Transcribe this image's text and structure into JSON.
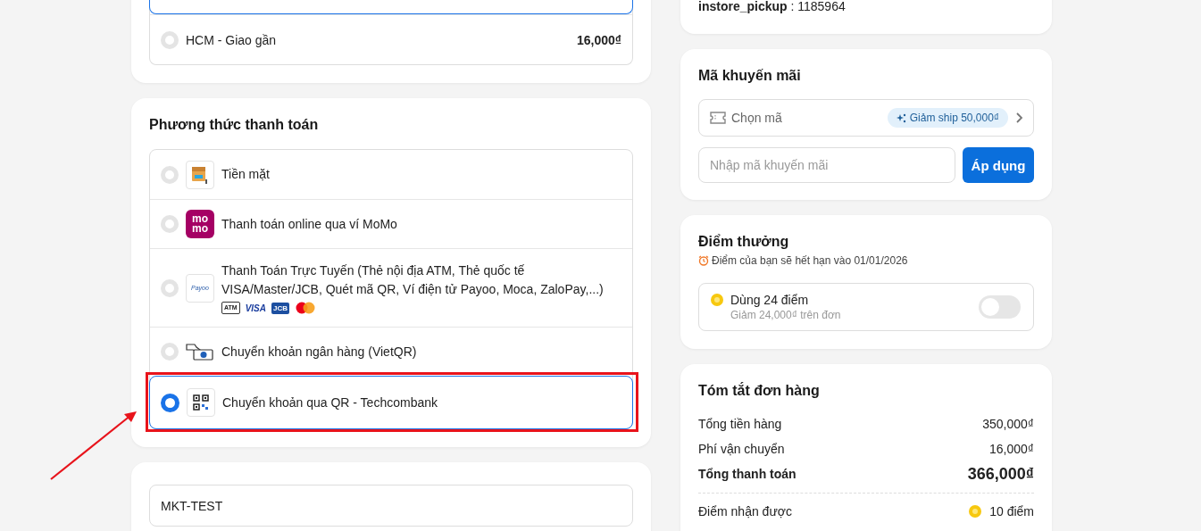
{
  "shipping": {
    "options": [
      {
        "selected": true
      },
      {
        "label": "HCM - Giao gần",
        "price": "16,000₫",
        "selected": false
      }
    ]
  },
  "payment": {
    "title": "Phương thức thanh toán",
    "methods": [
      {
        "kind": "cash",
        "label": "Tiền mặt",
        "selected": false
      },
      {
        "kind": "momo",
        "label": "Thanh toán online qua ví MoMo",
        "logo_lines": [
          "mo",
          "mo"
        ],
        "selected": false
      },
      {
        "kind": "payoo",
        "label": "Thanh Toán Trực Tuyến (Thẻ nội địa ATM, Thẻ quốc tế VISA/Master/JCB, Quét mã QR, Ví điện tử Payoo, Moca, ZaloPay,...)",
        "logo_text": "Payoo",
        "card_logos": [
          {
            "kind": "atm",
            "text": "ATM"
          },
          {
            "kind": "visa",
            "text": "VISA"
          },
          {
            "kind": "jcb",
            "text": "JCB"
          },
          {
            "kind": "mastercard"
          }
        ],
        "selected": false
      },
      {
        "kind": "bank",
        "label": "Chuyển khoản ngân hàng (VietQR)",
        "selected": false
      },
      {
        "kind": "qr",
        "label": "Chuyển khoản qua QR - Techcombank",
        "selected": true
      }
    ]
  },
  "note": {
    "value": "MKT-TEST"
  },
  "pickup": {
    "text": "**instore_pickup** : 1185964"
  },
  "promo": {
    "title": "Mã khuyến mãi",
    "picker_label": "Chọn mã",
    "badge": "Giảm ship 50,000₫",
    "input_placeholder": "Nhập mã khuyến mãi",
    "apply_button": "Áp dụng"
  },
  "points": {
    "title": "Điểm thưởng",
    "expiry": "Điểm của bạn sẽ hết hạn vào 01/01/2026",
    "use_label": "Dùng 24 điểm",
    "use_note": "Giảm 24,000₫ trên đơn",
    "on": false
  },
  "summary": {
    "title": "Tóm tắt đơn hàng",
    "rows": [
      {
        "kind": "line",
        "label": "Tổng tiền hàng",
        "value": "350,000₫"
      },
      {
        "kind": "line",
        "label": "Phí vận chuyển",
        "value": "16,000₫"
      },
      {
        "kind": "total",
        "label": "Tổng thanh toán",
        "value": "366,000₫"
      },
      {
        "kind": "points",
        "label": "Điểm nhận được",
        "value": "10 điểm"
      }
    ]
  }
}
